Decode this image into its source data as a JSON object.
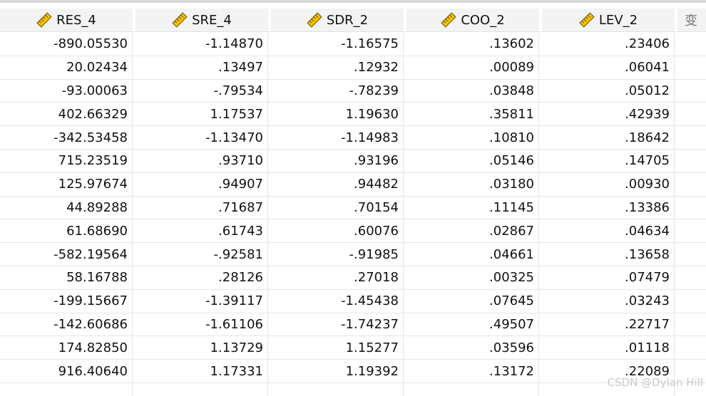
{
  "columns": [
    {
      "name": "RES_4"
    },
    {
      "name": "SRE_4"
    },
    {
      "name": "SDR_2"
    },
    {
      "name": "COO_2"
    },
    {
      "name": "LEV_2"
    }
  ],
  "partial_header": "变",
  "rows": [
    [
      "-890.05530",
      "-1.14870",
      "-1.16575",
      ".13602",
      ".23406"
    ],
    [
      "20.02434",
      ".13497",
      ".12932",
      ".00089",
      ".06041"
    ],
    [
      "-93.00063",
      "-.79534",
      "-.78239",
      ".03848",
      ".05012"
    ],
    [
      "402.66329",
      "1.17537",
      "1.19630",
      ".35811",
      ".42939"
    ],
    [
      "-342.53458",
      "-1.13470",
      "-1.14983",
      ".10810",
      ".18642"
    ],
    [
      "715.23519",
      ".93710",
      ".93196",
      ".05146",
      ".14705"
    ],
    [
      "125.97674",
      ".94907",
      ".94482",
      ".03180",
      ".00930"
    ],
    [
      "44.89288",
      ".71687",
      ".70154",
      ".11145",
      ".13386"
    ],
    [
      "61.68690",
      ".61743",
      ".60076",
      ".02867",
      ".04634"
    ],
    [
      "-582.19564",
      "-.92581",
      "-.91985",
      ".04661",
      ".13658"
    ],
    [
      "58.16788",
      ".28126",
      ".27018",
      ".00325",
      ".07479"
    ],
    [
      "-199.15667",
      "-1.39117",
      "-1.45438",
      ".07645",
      ".03243"
    ],
    [
      "-142.60686",
      "-1.61106",
      "-1.74237",
      ".49507",
      ".22717"
    ],
    [
      "174.82850",
      "1.13729",
      "1.15277",
      ".03596",
      ".01118"
    ],
    [
      "916.40640",
      "1.17331",
      "1.19392",
      ".13172",
      ".22089"
    ],
    [
      "",
      "",
      "",
      "",
      ""
    ]
  ],
  "watermark": "CSDN @Dylan Hill",
  "icon": "ruler-icon"
}
